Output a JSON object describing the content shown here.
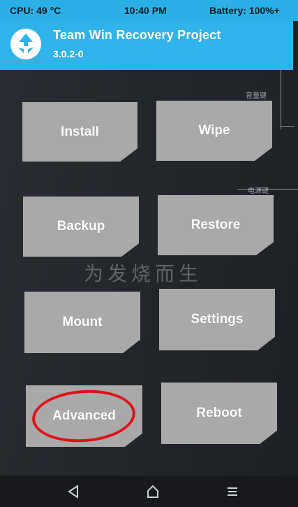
{
  "status_bar": {
    "cpu": "CPU: 49 °C",
    "time": "10:40 PM",
    "battery": "Battery: 100%+"
  },
  "header": {
    "title": "Team Win Recovery Project",
    "version": "3.0.2-0",
    "logo_icon": "twrp-logo-icon"
  },
  "side_labels": {
    "volume_key": "音量键",
    "power_key": "电源键"
  },
  "watermark": "为发烧而生",
  "buttons": {
    "install": "Install",
    "wipe": "Wipe",
    "backup": "Backup",
    "restore": "Restore",
    "mount": "Mount",
    "settings": "Settings",
    "advanced": "Advanced",
    "reboot": "Reboot"
  },
  "annotation": {
    "highlight_color": "#e0101b",
    "highlighted_button": "Advanced"
  },
  "navbar": {
    "back_icon": "back-triangle-icon",
    "home_icon": "home-icon",
    "menu_icon": "menu-lines-icon"
  },
  "colors": {
    "accent": "#2fb3ea",
    "button": "#a9a9a9",
    "background": "#24272c"
  }
}
